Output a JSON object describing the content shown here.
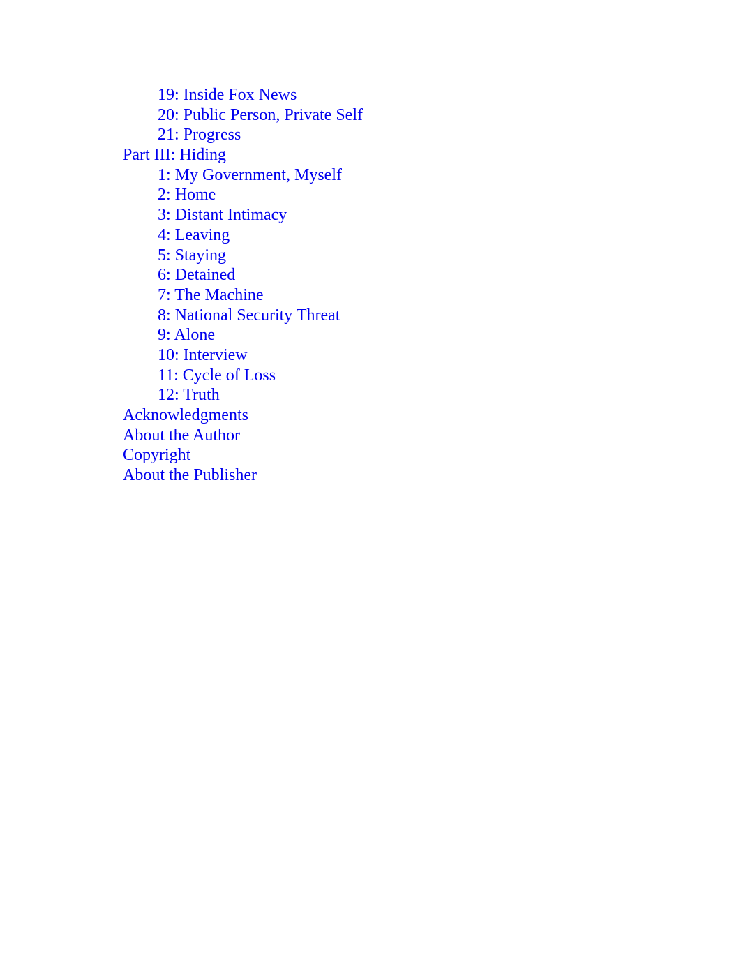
{
  "link_color": "#0000ee",
  "toc": {
    "items": [
      {
        "label": "19: Inside Fox News",
        "level": 2
      },
      {
        "label": "20: Public Person, Private Self",
        "level": 2
      },
      {
        "label": "21: Progress",
        "level": 2
      },
      {
        "label": "Part III: Hiding",
        "level": 1
      },
      {
        "label": "1: My Government, Myself",
        "level": 2
      },
      {
        "label": "2: Home",
        "level": 2
      },
      {
        "label": "3: Distant Intimacy",
        "level": 2
      },
      {
        "label": "4: Leaving",
        "level": 2
      },
      {
        "label": "5: Staying",
        "level": 2
      },
      {
        "label": "6: Detained",
        "level": 2
      },
      {
        "label": "7: The Machine",
        "level": 2
      },
      {
        "label": "8: National Security Threat",
        "level": 2
      },
      {
        "label": "9: Alone",
        "level": 2
      },
      {
        "label": "10: Interview",
        "level": 2
      },
      {
        "label": "11: Cycle of Loss",
        "level": 2
      },
      {
        "label": "12: Truth",
        "level": 2
      },
      {
        "label": "Acknowledgments",
        "level": 1
      },
      {
        "label": "About the Author",
        "level": 1
      },
      {
        "label": "Copyright",
        "level": 1
      },
      {
        "label": "About the Publisher",
        "level": 1
      }
    ]
  }
}
